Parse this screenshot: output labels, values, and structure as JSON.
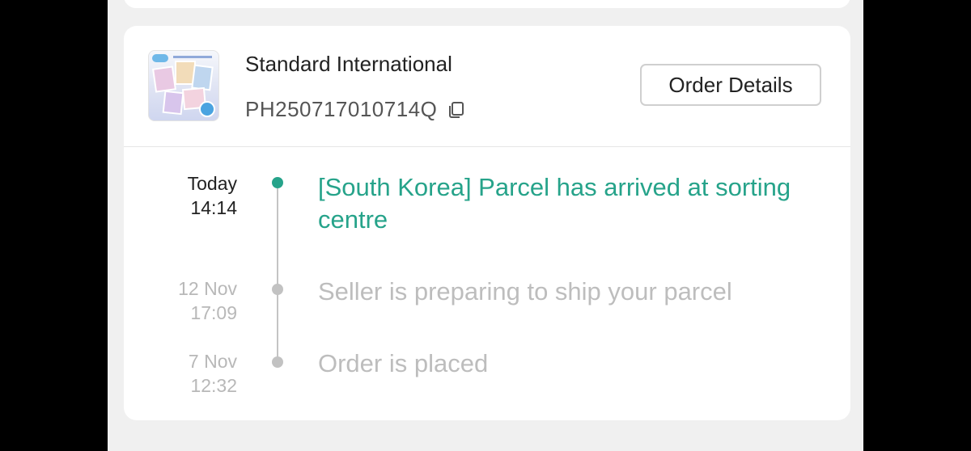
{
  "shipment": {
    "carrier": "Standard International",
    "tracking_number": "PH250717010714Q",
    "order_details_label": "Order Details"
  },
  "timeline": [
    {
      "day": "Today",
      "time": "14:14",
      "event": "[South Korea] Parcel has arrived at sorting centre",
      "active": true
    },
    {
      "day": "12 Nov",
      "time": "17:09",
      "event": "Seller is preparing to ship your parcel",
      "active": false
    },
    {
      "day": "7 Nov",
      "time": "12:32",
      "event": "Order is placed",
      "active": false
    }
  ],
  "colors": {
    "accent": "#26a38a",
    "inactive_text": "#bdbdbd",
    "background": "#f0f0f0"
  },
  "icons": {
    "copy": "copy-icon",
    "product_thumbnail": "product-thumbnail"
  }
}
